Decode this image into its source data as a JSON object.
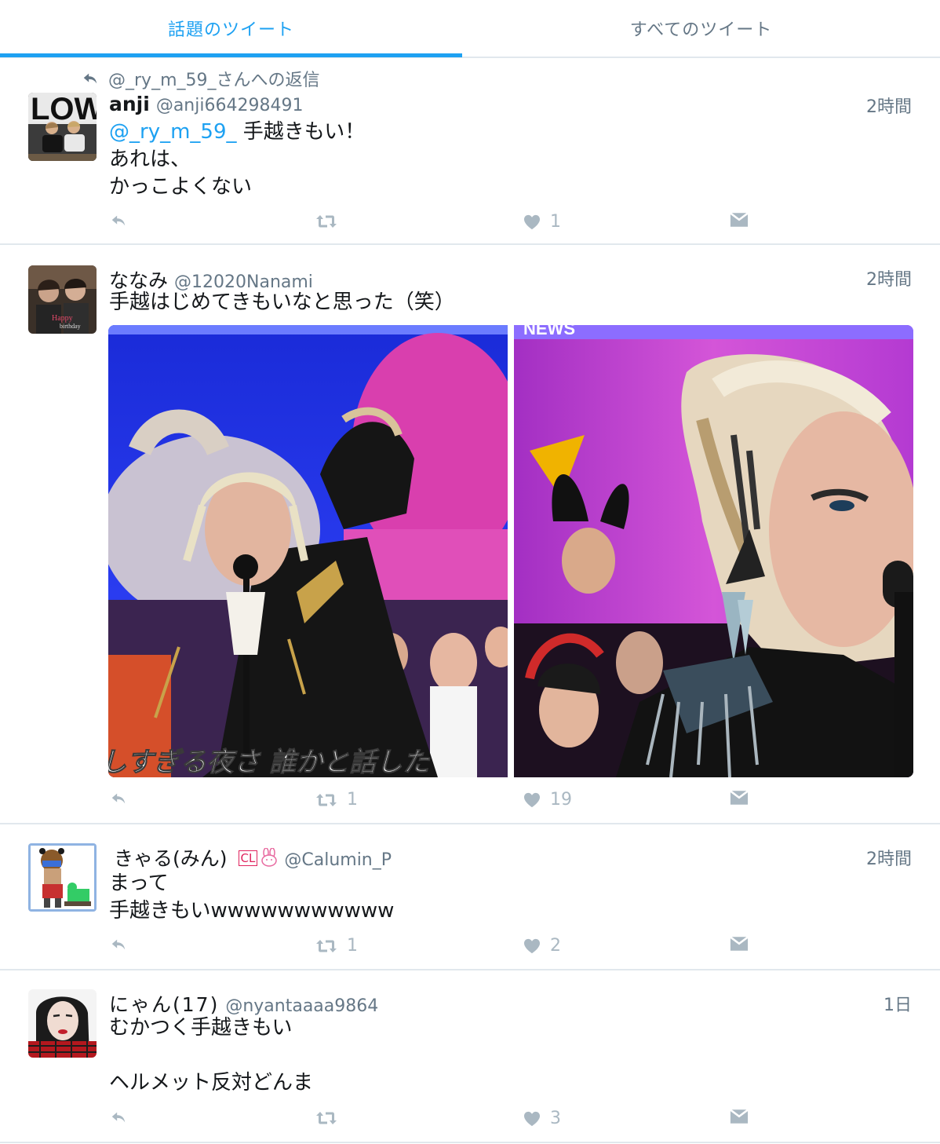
{
  "tabs": {
    "top_tweets": "話題のツイート",
    "all_tweets": "すべてのツイート"
  },
  "tweets": [
    {
      "reply_context": "@_ry_m_59_さんへの返信",
      "display_name": "anji",
      "screen_name": "@anji664298491",
      "time": "2時間",
      "mention": "@_ry_m_59_",
      "lines": [
        "手越きもい！",
        "あれは、",
        "かっこよくない"
      ],
      "retweets": "",
      "likes": "1"
    },
    {
      "display_name": "ななみ",
      "screen_name": "@12020Nanami",
      "time": "2時間",
      "lines": [
        "手越はじめてきもいなと思った（笑）"
      ],
      "media_caption": "しすぎる夜さ 誰かと話した",
      "media_logo": "NEWS",
      "retweets": "1",
      "likes": "19"
    },
    {
      "display_name": "きゃる(みん)",
      "badge": "CL",
      "screen_name": "@Calumin_P",
      "time": "2時間",
      "lines": [
        "まって",
        "手越きもいwwwwwwwwwww"
      ],
      "retweets": "1",
      "likes": "2"
    },
    {
      "display_name": "にゃん(17)",
      "screen_name": "@nyantaaaa9864",
      "time": "1日",
      "lines": [
        "むかつく手越きもい",
        "",
        "ヘルメット反対どんま"
      ],
      "retweets": "",
      "likes": "3"
    }
  ],
  "icons": {
    "reply": "reply-arrow-icon",
    "retweet": "retweet-icon",
    "like": "heart-icon",
    "dm": "envelope-icon"
  },
  "colors": {
    "accent": "#1da1f2",
    "muted": "#657786",
    "action": "#aab8c2",
    "divider": "#e1e8ed"
  }
}
